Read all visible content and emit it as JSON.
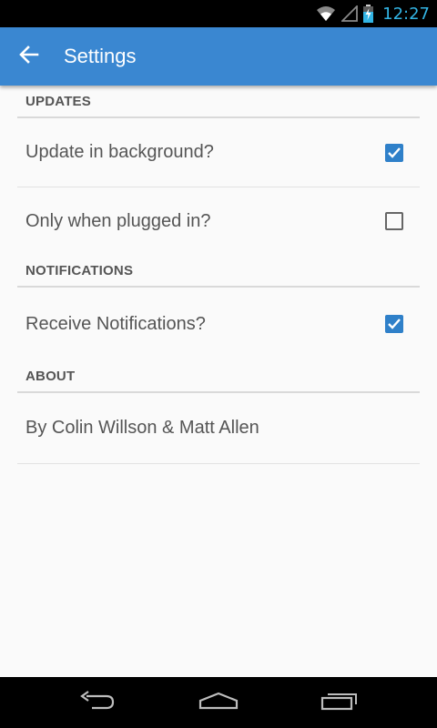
{
  "status_bar": {
    "time": "12:27",
    "icons": [
      "wifi-icon",
      "signal-icon",
      "battery-charging-icon"
    ],
    "time_color": "#33b5e5"
  },
  "app_bar": {
    "title": "Settings",
    "background_color": "#3a87d1",
    "back_icon": "arrow-back-icon"
  },
  "sections": {
    "updates": {
      "header": "UPDATES",
      "items": [
        {
          "label": "Update in background?",
          "checked": true
        },
        {
          "label": "Only when plugged in?",
          "checked": false
        }
      ]
    },
    "notifications": {
      "header": "NOTIFICATIONS",
      "items": [
        {
          "label": "Receive Notifications?",
          "checked": true
        }
      ]
    },
    "about": {
      "header": "ABOUT",
      "text": "By Colin Willson & Matt Allen"
    }
  },
  "checkbox_color": "#2f80c9",
  "nav_bar": {
    "buttons": [
      "back-nav-icon",
      "home-nav-icon",
      "recents-nav-icon"
    ]
  }
}
